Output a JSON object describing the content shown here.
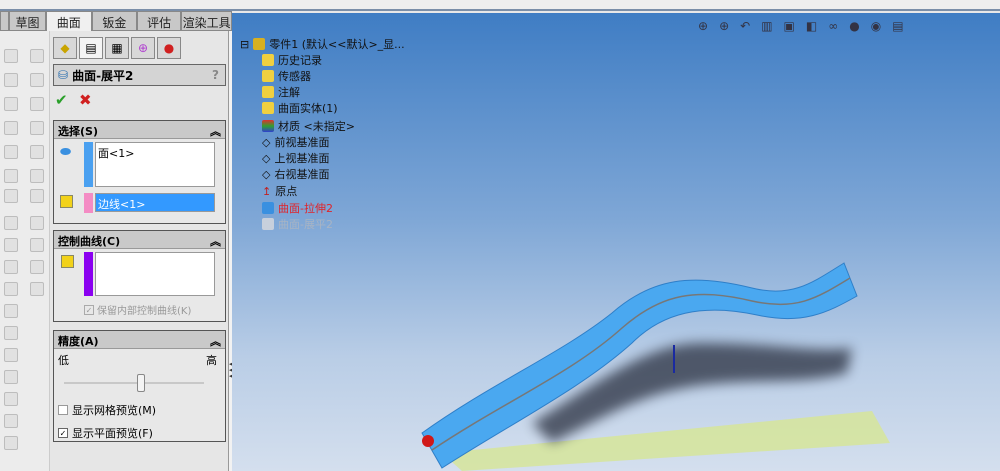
{
  "tabs": [
    "草图",
    "曲面",
    "钣金",
    "评估",
    "渲染工具"
  ],
  "active_tab": "曲面",
  "property_manager": {
    "title": "曲面-展平2",
    "help_icons": "?",
    "ok": "✔",
    "cancel": "✖",
    "selection": {
      "header": "选择(S)",
      "face_value": "面<1>",
      "edge_value": "边线<1>"
    },
    "control_curves": {
      "header": "控制曲线(C)",
      "keep_internal_label": "保留内部控制曲线(K)",
      "keep_internal_checked": true
    },
    "accuracy": {
      "header": "精度(A)",
      "low": "低",
      "high": "高",
      "slider_value": 0.55,
      "show_mesh_label": "显示网格预览(M)",
      "show_mesh_checked": false,
      "show_flat_label": "显示平面预览(F)",
      "show_flat_checked": true
    }
  },
  "tree": {
    "root": "零件1  (默认<<默认>_显...",
    "items": [
      "历史记录",
      "传感器",
      "注解",
      "曲面实体(1)",
      "材质 <未指定>",
      "前视基准面",
      "上视基准面",
      "右视基准面",
      "原点",
      "曲面-拉伸2",
      "曲面-展平2"
    ]
  },
  "colors": {
    "accent": "#3399ff",
    "tree_error": "#e0242a",
    "surface": "#4aa8f0"
  }
}
